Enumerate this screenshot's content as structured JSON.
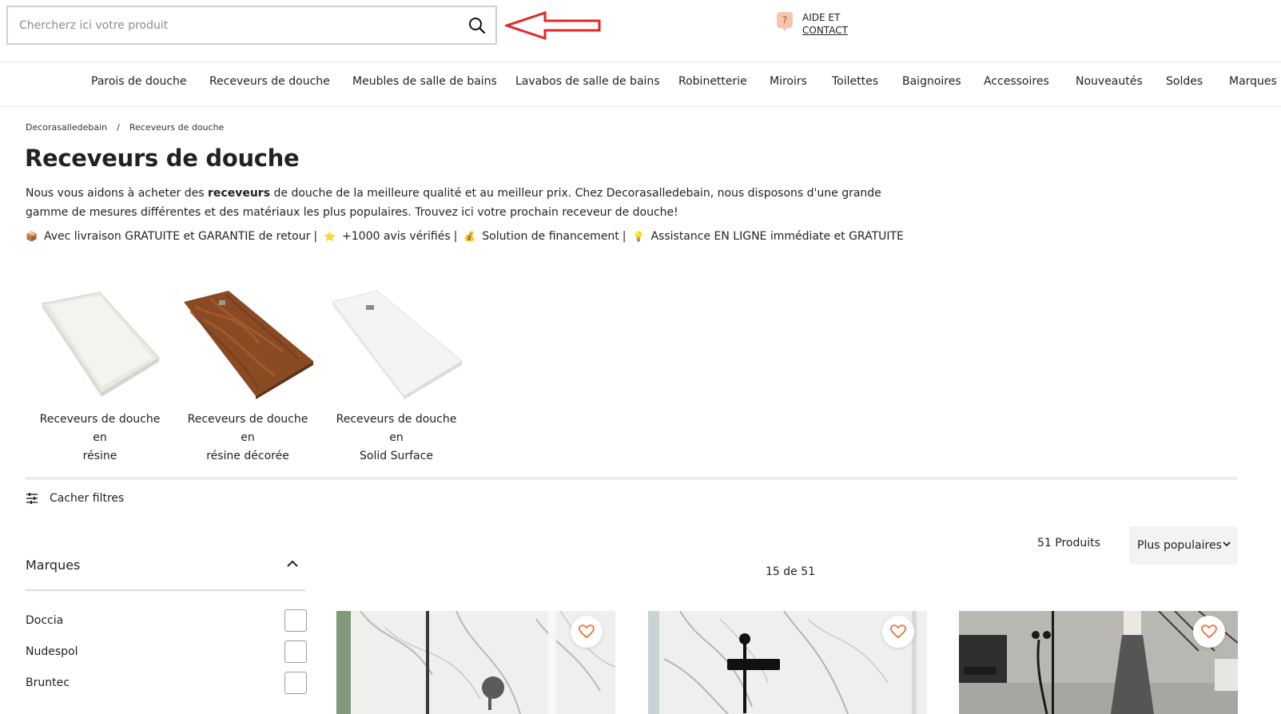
{
  "header": {
    "search": {
      "placeholder": "Chercherz ici votre produit",
      "value": ""
    },
    "help": {
      "icon": "question-bubble-icon",
      "line1": "AIDE ET",
      "line2": "CONTACT"
    }
  },
  "nav": {
    "items": [
      {
        "label": "Parois de douche"
      },
      {
        "label": "Receveurs de douche"
      },
      {
        "label": "Meubles de salle de bains"
      },
      {
        "label": "Lavabos de salle de bains"
      },
      {
        "label": "Robinetterie"
      },
      {
        "label": "Miroirs"
      },
      {
        "label": "Toilettes"
      },
      {
        "label": "Baignoires"
      },
      {
        "label": "Accessoires"
      },
      {
        "label": "Nouveautés"
      },
      {
        "label": "Soldes"
      },
      {
        "label": "Marques"
      }
    ]
  },
  "breadcrumb": {
    "items": [
      "Decorasalledebain",
      "Receveurs de douche"
    ],
    "separator": "/"
  },
  "page": {
    "title": "Receveurs de douche",
    "desc_before": "Nous vous aidons à acheter des ",
    "desc_bold": "receveurs",
    "desc_after": " de douche de la meilleure qualité et au meilleur prix. Chez Decorasalledebain, nous disposons d'une grande gamme de mesures différentes et des matériaux les plus populaires. Trouvez ici votre prochain receveur de douche!",
    "benefits": [
      {
        "emoji": "📦",
        "text": "Avec livraison GRATUITE et GARANTIE de retour"
      },
      {
        "emoji": "⭐",
        "text": "+1000 avis vérifiés"
      },
      {
        "emoji": "💰",
        "text": "Solution de financement"
      },
      {
        "emoji": "💡",
        "text": "Assistance EN LIGNE immédiate et GRATUITE"
      }
    ],
    "benefit_separator": "|"
  },
  "categories": [
    {
      "line1": "Receveurs de douche en",
      "line2": "résine",
      "color": "#ecebe6"
    },
    {
      "line1": "Receveurs de douche en",
      "line2": "résine décorée",
      "color": "#8a4a23"
    },
    {
      "line1": "Receveurs de douche en",
      "line2": "Solid Surface",
      "color": "#f4f4f2"
    }
  ],
  "filters": {
    "toggle_label": "Cacher filtres",
    "brands_title": "Marques",
    "brands": [
      {
        "label": "Doccia",
        "checked": false
      },
      {
        "label": "Nudespol",
        "checked": false
      },
      {
        "label": "Bruntec",
        "checked": false
      }
    ]
  },
  "listing": {
    "count": "51 Produits",
    "sort_label": "Plus populaires",
    "pager": "15 de 51"
  },
  "colors": {
    "annotation_arrow": "#e3262b",
    "accent": "#e8743b"
  }
}
